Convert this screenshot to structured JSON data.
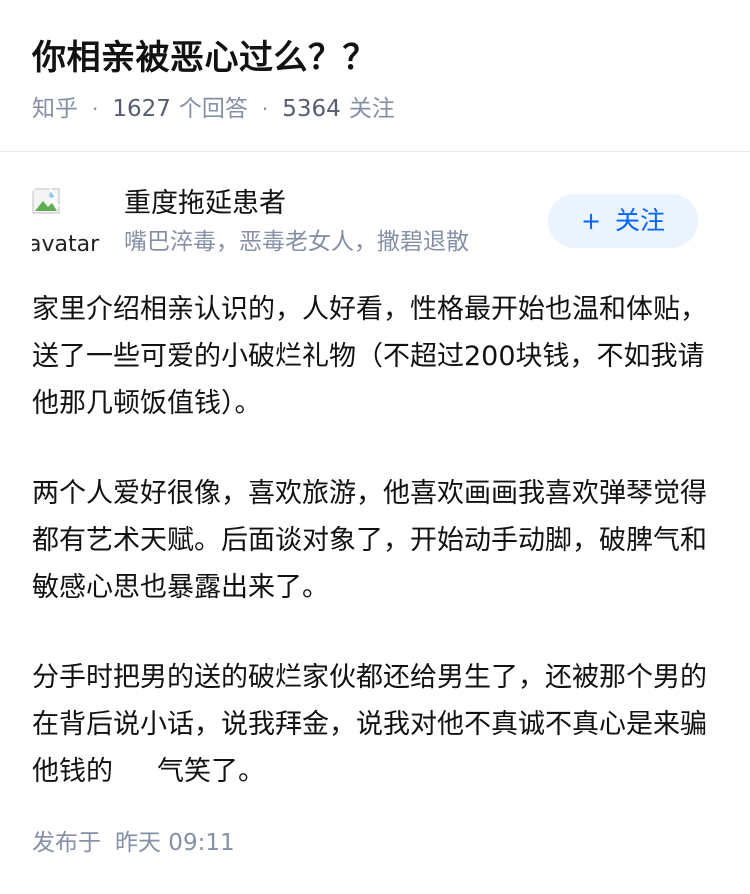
{
  "question": {
    "title": "你相亲被恶心过么？？",
    "source": "知乎",
    "answer_count": "1627",
    "answer_label": "个回答",
    "follower_count": "5364",
    "follower_label": "关注",
    "separator": "·"
  },
  "author": {
    "avatar_alt": "avatar",
    "name": "重度拖延患者",
    "bio": "嘴巴淬毒，恶毒老女人，撒碧退散",
    "follow_label": "关注",
    "follow_icon": "+"
  },
  "answer": {
    "paragraphs": [
      "家里介绍相亲认识的，人好看，性格最开始也温和体贴，送了一些可爱的小破烂礼物（不超过200块钱，不如我请他那几顿饭值钱）。",
      "两个人爱好很像，喜欢旅游，他喜欢画画我喜欢弹琴觉得都有艺术天赋。后面谈对象了，开始动手动脚，破脾气和敏感心思也暴露出来了。",
      "分手时把男的送的破烂家伙都还给男生了，还被那个男的在背后说小话，说我拜金，说我对他不真诚不真心是来骗他钱的"
    ],
    "paragraph3_tail": "气笑了。",
    "published_label": "发布于",
    "published_time": "昨天 09:11"
  }
}
